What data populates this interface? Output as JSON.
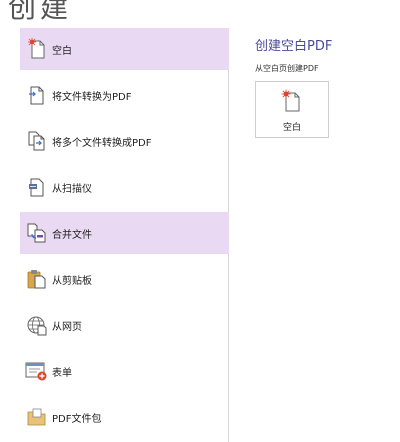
{
  "page_title": "创建",
  "sidebar": {
    "items": [
      {
        "label": "空白",
        "icon": "blank-page-icon",
        "selected": true
      },
      {
        "label": "将文件转换为PDF",
        "icon": "convert-file-icon",
        "selected": false
      },
      {
        "label": "将多个文件转换成PDF",
        "icon": "convert-multiple-icon",
        "selected": false
      },
      {
        "label": "从扫描仪",
        "icon": "scanner-icon",
        "selected": false
      },
      {
        "label": "合并文件",
        "icon": "merge-files-icon",
        "selected": true
      },
      {
        "label": "从剪贴板",
        "icon": "clipboard-icon",
        "selected": false
      },
      {
        "label": "从网页",
        "icon": "globe-icon",
        "selected": false
      },
      {
        "label": "表单",
        "icon": "form-icon",
        "selected": false
      },
      {
        "label": "PDF文件包",
        "icon": "portfolio-folder-icon",
        "selected": false
      }
    ]
  },
  "content": {
    "title": "创建空白PDF",
    "subtitle": "从空白页创建PDF",
    "tile_label": "空白"
  },
  "colors": {
    "selected_bg": "#ead9f2",
    "title_blue": "#4a4a9a",
    "accent_red": "#e0452a",
    "folder_tan": "#e9c27a"
  }
}
